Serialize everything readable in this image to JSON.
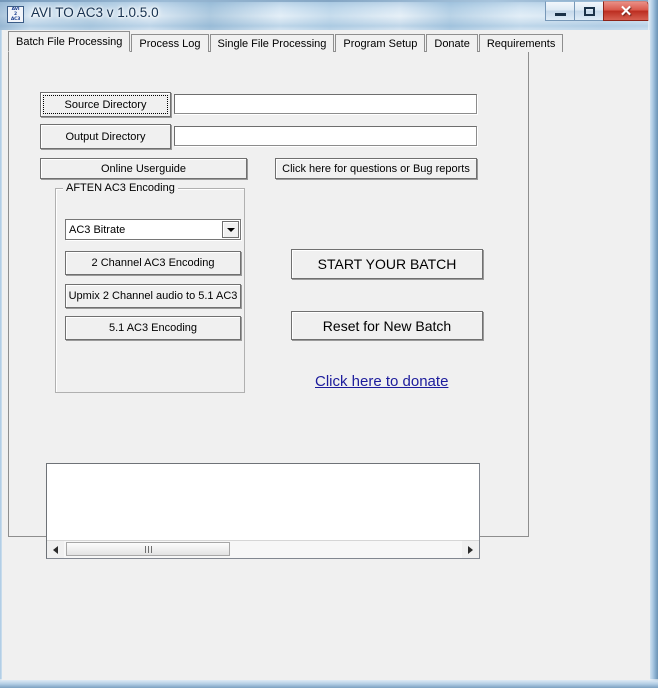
{
  "window": {
    "title": "AVI TO AC3 v 1.0.5.0",
    "icon_line1": "AVI",
    "icon_line2": "2",
    "icon_line3": "AC3",
    "icon_name": "avi-to-ac3-app-icon",
    "minimize_label": "",
    "maximize_label": "",
    "close_label": "✕"
  },
  "tabs": [
    {
      "label": "Batch File Processing",
      "selected": true
    },
    {
      "label": "Process Log",
      "selected": false
    },
    {
      "label": "Single File Processing",
      "selected": false
    },
    {
      "label": "Program Setup",
      "selected": false
    },
    {
      "label": "Donate",
      "selected": false
    },
    {
      "label": "Requirements",
      "selected": false
    }
  ],
  "batch_tab": {
    "source_directory_button": "Source Directory",
    "source_directory_value": "",
    "source_directory_placeholder": "",
    "output_directory_button": "Output Directory",
    "output_directory_value": "",
    "output_directory_placeholder": "",
    "online_userguide_button": "Online Userguide",
    "bug_reports_button": "Click here for questions or Bug reports",
    "groupbox_title": "AFTEN AC3 Encoding",
    "bitrate_combo_value": "AC3 Bitrate",
    "encode_2ch_button": "2 Channel AC3 Encoding",
    "upmix_button": "Upmix 2 Channel audio to 5.1 AC3",
    "encode_51_button": "5.1 AC3 Encoding",
    "start_batch_button": "START YOUR BATCH",
    "reset_batch_button": "Reset for New Batch",
    "donate_link": "Click here to donate",
    "log_text": ""
  },
  "colors": {
    "link": "#1c1c9c",
    "face": "#f0f0f0",
    "field": "#ffffff",
    "close_button": "#bc2d20"
  }
}
